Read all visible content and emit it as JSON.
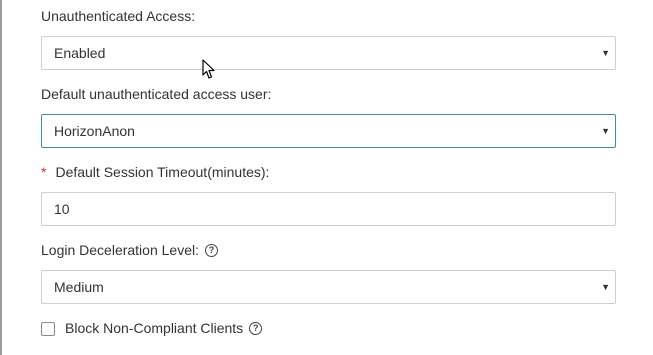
{
  "unauth_access": {
    "label": "Unauthenticated Access:",
    "value": "Enabled"
  },
  "default_user": {
    "label": "Default unauthenticated access user:",
    "value": "HorizonAnon"
  },
  "session_timeout": {
    "required_marker": "*",
    "label": "Default Session Timeout(minutes):",
    "value": "10"
  },
  "login_deceleration": {
    "label": "Login Deceleration Level:",
    "value": "Medium"
  },
  "block_clients": {
    "label": "Block Non-Compliant Clients",
    "checked": false
  },
  "icons": {
    "help": "question-circle-icon",
    "dropdown": "caret-down-icon",
    "cursor": "mouse-pointer-icon"
  }
}
